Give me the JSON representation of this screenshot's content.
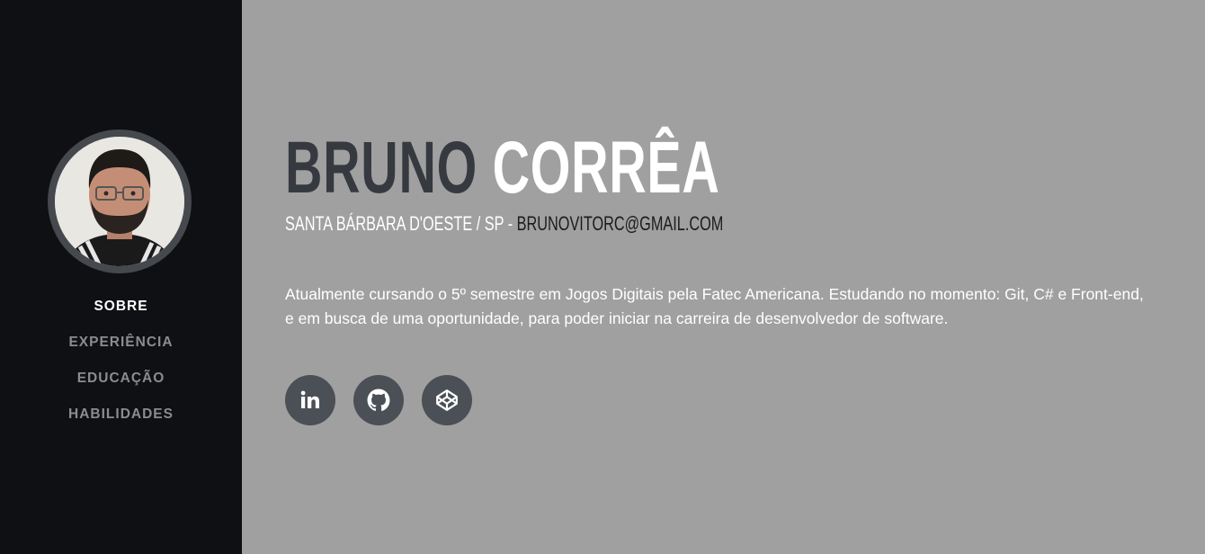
{
  "profile": {
    "first_name": "Bruno",
    "last_name": "Corrêa",
    "location": "Santa Bárbara D'Oeste / SP",
    "separator": " - ",
    "email": "brunovitorc@gmail.com",
    "bio": "Atualmente cursando o 5º semestre em Jogos Digitais pela Fatec Americana. Estudando no momento: Git, C# e Front-end, e em busca de uma oportunidade, para poder iniciar na carreira de desenvolvedor de software."
  },
  "nav": {
    "items": [
      {
        "label": "SOBRE"
      },
      {
        "label": "EXPERIÊNCIA"
      },
      {
        "label": "EDUCAÇÃO"
      },
      {
        "label": "HABILIDADES"
      }
    ]
  },
  "socials": [
    {
      "icon": "linkedin-icon"
    },
    {
      "icon": "github-icon"
    },
    {
      "icon": "codepen-icon"
    }
  ],
  "colors": {
    "sidebar_bg": "#0f1013",
    "main_bg": "#a0a0a0",
    "name_dark": "#363a40",
    "social_bg": "#4b4f56"
  }
}
